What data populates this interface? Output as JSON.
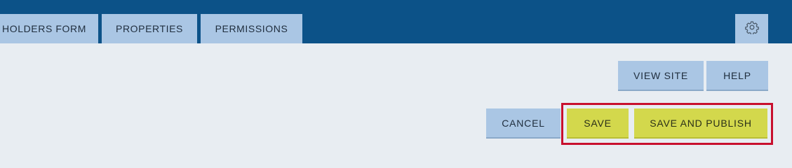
{
  "tabs": [
    {
      "label": "HOLDERS FORM"
    },
    {
      "label": "PROPERTIES"
    },
    {
      "label": "PERMISSIONS"
    }
  ],
  "header": {
    "settings_icon": "gear-icon"
  },
  "actions": {
    "view_site": "VIEW SITE",
    "help": "HELP",
    "cancel": "CANCEL",
    "save": "SAVE",
    "save_and_publish": "SAVE AND PUBLISH"
  },
  "colors": {
    "topbar": "#0c5288",
    "tab_background": "#aac6e4",
    "page_background": "#e8edf2",
    "save_button": "#d3d84c",
    "highlight_border": "#c8102e"
  }
}
